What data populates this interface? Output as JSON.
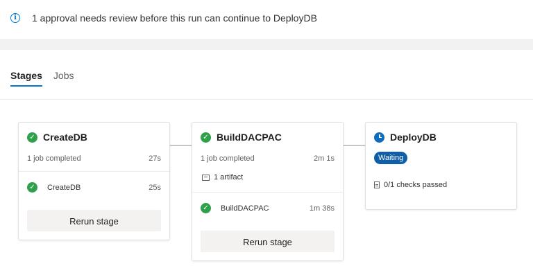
{
  "banner": {
    "message": "1 approval needs review before this run can continue to DeployDB"
  },
  "tabs": [
    {
      "label": "Stages",
      "active": true
    },
    {
      "label": "Jobs",
      "active": false
    }
  ],
  "stages": [
    {
      "name": "CreateDB",
      "status": "succeeded",
      "summary": "1 job completed",
      "duration": "27s",
      "jobs": [
        {
          "name": "CreateDB",
          "duration": "25s",
          "status": "succeeded"
        }
      ],
      "button": "Rerun stage"
    },
    {
      "name": "BuildDACPAC",
      "status": "succeeded",
      "summary": "1 job completed",
      "duration": "2m 1s",
      "artifact": "1 artifact",
      "jobs": [
        {
          "name": "BuildDACPAC",
          "duration": "1m 38s",
          "status": "succeeded"
        }
      ],
      "button": "Rerun stage"
    },
    {
      "name": "DeployDB",
      "status": "waiting",
      "badge": "Waiting",
      "checks": "0/1 checks passed"
    }
  ],
  "colors": {
    "accent": "#0078d4",
    "success": "#2fa14a",
    "waiting": "#0f5ea8"
  }
}
